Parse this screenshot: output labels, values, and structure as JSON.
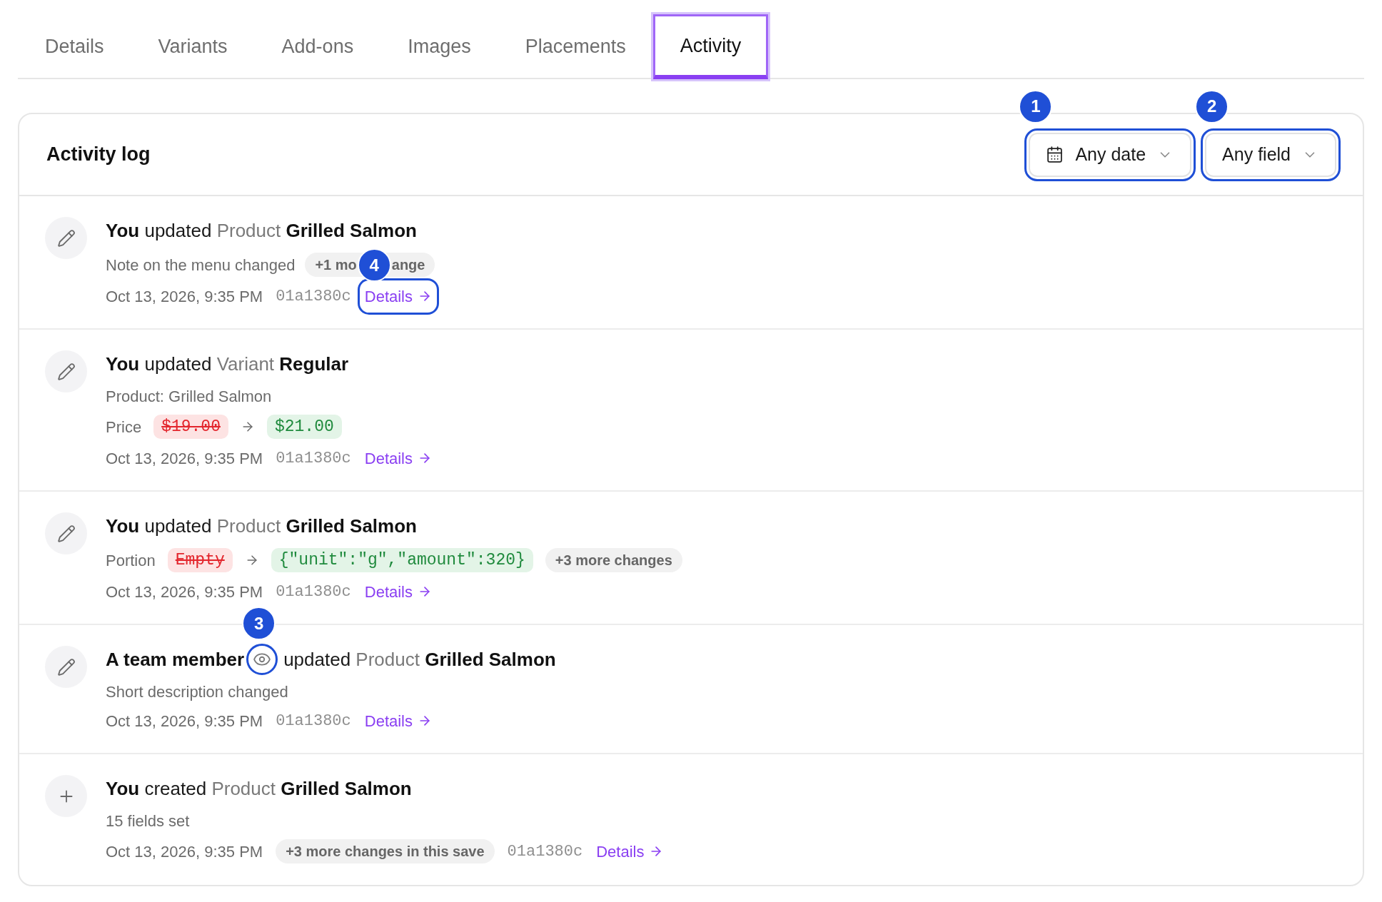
{
  "tabs": [
    {
      "label": "Details",
      "selected": false
    },
    {
      "label": "Variants",
      "selected": false
    },
    {
      "label": "Add-ons",
      "selected": false
    },
    {
      "label": "Images",
      "selected": false
    },
    {
      "label": "Placements",
      "selected": false
    },
    {
      "label": "Activity",
      "selected": true
    }
  ],
  "activity_log": {
    "title": "Activity log",
    "filters": [
      {
        "kind": "date",
        "label": "Any date",
        "highlighted": true,
        "callout": "1"
      },
      {
        "kind": "field",
        "label": "Any field",
        "highlighted": true,
        "callout": "2"
      }
    ],
    "entries": [
      {
        "kind": "update",
        "actor": "You",
        "verb": "updated",
        "object_type": "Product",
        "object_name": "Grilled Salmon",
        "lines": [
          {
            "kind": "note",
            "text": "Note on the menu changed",
            "chip": {
              "parts": [
                "+1 mo",
                "ange"
              ],
              "callout": "4"
            }
          }
        ],
        "meta": {
          "time": "Oct 13, 2026, 9:35 PM",
          "hash": "01a1380c",
          "link": {
            "label": "Details",
            "highlighted": true
          }
        }
      },
      {
        "kind": "update",
        "actor": "You",
        "verb": "updated",
        "object_type": "Variant",
        "object_name": "Regular",
        "lines": [
          {
            "kind": "note",
            "text": "Product: Grilled Salmon"
          },
          {
            "kind": "change",
            "field": "Price",
            "old": "$19.00",
            "new": "$21.00"
          }
        ],
        "meta": {
          "time": "Oct 13, 2026, 9:35 PM",
          "hash": "01a1380c",
          "link": {
            "label": "Details",
            "highlighted": false
          }
        }
      },
      {
        "kind": "update",
        "actor": "You",
        "verb": "updated",
        "object_type": "Product",
        "object_name": "Grilled Salmon",
        "lines": [
          {
            "kind": "change",
            "field": "Portion",
            "old": "Empty",
            "new": "{\"unit\":\"g\",\"amount\":320}",
            "chip": {
              "parts": [
                "+3 more changes"
              ]
            }
          }
        ],
        "meta": {
          "time": "Oct 13, 2026, 9:35 PM",
          "hash": "01a1380c",
          "link": {
            "label": "Details",
            "highlighted": false
          }
        }
      },
      {
        "kind": "update",
        "actor": "A team member",
        "actor_icon": {
          "highlighted": true,
          "callout": "3"
        },
        "verb": "updated",
        "object_type": "Product",
        "object_name": "Grilled Salmon",
        "lines": [
          {
            "kind": "note",
            "text": "Short description changed"
          }
        ],
        "meta": {
          "time": "Oct 13, 2026, 9:35 PM",
          "hash": "01a1380c",
          "link": {
            "label": "Details",
            "highlighted": false
          }
        }
      },
      {
        "kind": "create",
        "actor": "You",
        "verb": "created",
        "object_type": "Product",
        "object_name": "Grilled Salmon",
        "lines": [
          {
            "kind": "note",
            "text": "15 fields set"
          }
        ],
        "meta": {
          "time": "Oct 13, 2026, 9:35 PM",
          "chip": {
            "parts": [
              "+3 more changes in this save"
            ]
          },
          "hash": "01a1380c",
          "link": {
            "label": "Details",
            "highlighted": false
          }
        }
      }
    ]
  }
}
